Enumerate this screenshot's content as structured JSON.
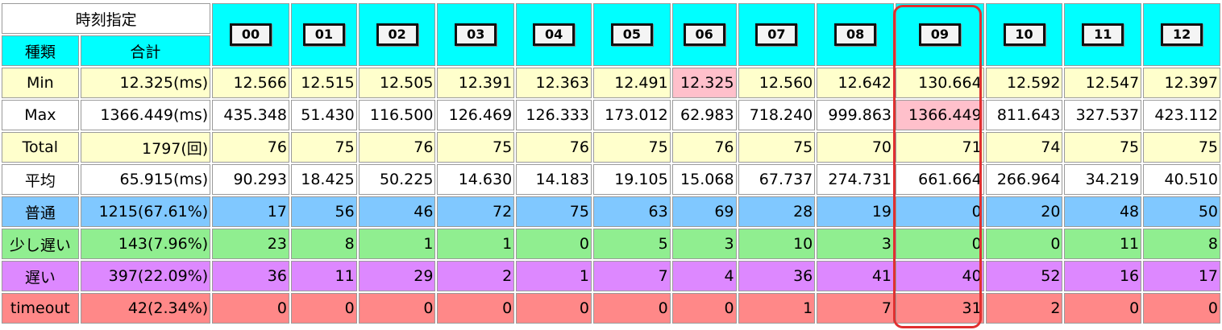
{
  "header": {
    "title": "時刻指定",
    "type_label": "種類",
    "total_label": "合計"
  },
  "hours": [
    "00",
    "01",
    "02",
    "03",
    "04",
    "05",
    "06",
    "07",
    "08",
    "09",
    "10",
    "11",
    "12"
  ],
  "rows": {
    "min": {
      "label": "Min",
      "total": "12.325(ms)",
      "values": [
        "12.566",
        "12.515",
        "12.505",
        "12.391",
        "12.363",
        "12.491",
        "12.325",
        "12.560",
        "12.642",
        "130.664",
        "12.592",
        "12.547",
        "12.397"
      ]
    },
    "max": {
      "label": "Max",
      "total": "1366.449(ms)",
      "values": [
        "435.348",
        "51.430",
        "116.500",
        "126.469",
        "126.333",
        "173.012",
        "62.983",
        "718.240",
        "999.863",
        "1366.449",
        "811.643",
        "327.537",
        "423.112"
      ]
    },
    "total": {
      "label": "Total",
      "total": "1797(回)",
      "values": [
        "76",
        "75",
        "76",
        "75",
        "76",
        "75",
        "76",
        "75",
        "70",
        "71",
        "74",
        "75",
        "75"
      ]
    },
    "avg": {
      "label": "平均",
      "total": "65.915(ms)",
      "values": [
        "90.293",
        "18.425",
        "50.225",
        "14.630",
        "14.183",
        "19.105",
        "15.068",
        "67.737",
        "274.731",
        "661.664",
        "266.964",
        "34.219",
        "40.510"
      ]
    },
    "normal": {
      "label": "普通",
      "total": "1215(67.61%)",
      "values": [
        "17",
        "56",
        "46",
        "72",
        "75",
        "63",
        "69",
        "28",
        "19",
        "0",
        "20",
        "48",
        "50"
      ]
    },
    "slow": {
      "label": "少し遅い",
      "total": "143(7.96%)",
      "values": [
        "23",
        "8",
        "1",
        "1",
        "0",
        "5",
        "3",
        "10",
        "3",
        "0",
        "0",
        "11",
        "8"
      ]
    },
    "late": {
      "label": "遅い",
      "total": "397(22.09%)",
      "values": [
        "36",
        "11",
        "29",
        "2",
        "1",
        "7",
        "4",
        "36",
        "41",
        "40",
        "52",
        "16",
        "17"
      ]
    },
    "timeout": {
      "label": "timeout",
      "total": "42(2.34%)",
      "values": [
        "0",
        "0",
        "0",
        "0",
        "0",
        "0",
        "0",
        "1",
        "7",
        "31",
        "2",
        "0",
        "0"
      ]
    }
  },
  "colors": {
    "header_cyan": "#00ffff",
    "min_max_highlight": "#ffc0cb",
    "yellow_rows": "#ffffcc",
    "normal": "#80c8ff",
    "slow": "#90ee90",
    "late": "#dd88ff",
    "timeout": "#ff8888",
    "column_highlight_border": "#e03030"
  },
  "highlighted_hour": "09"
}
